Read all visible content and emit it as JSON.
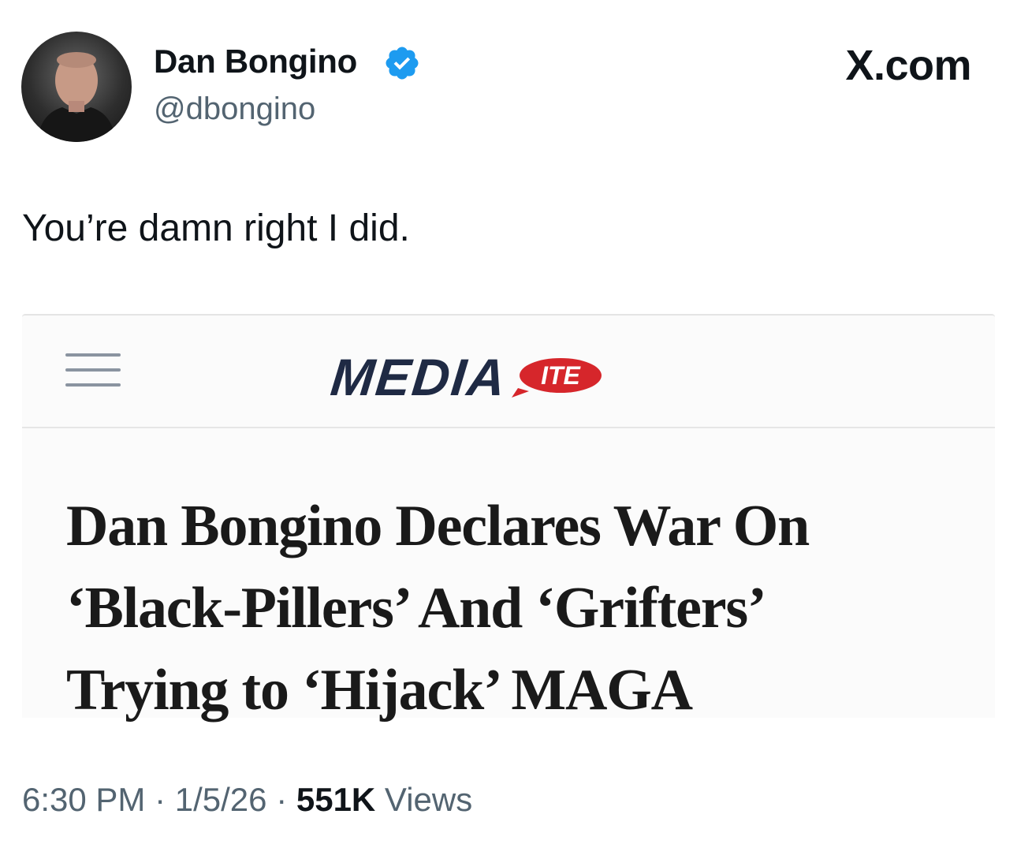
{
  "tweet": {
    "author": {
      "display_name": "Dan Bongino",
      "handle": "@dbongino",
      "verified": true,
      "verified_color": "#1d9bf0"
    },
    "brand": "X.com",
    "text": "You’re damn right I did.",
    "card": {
      "site_logo_main": "MEDIA",
      "site_logo_badge": "ITE",
      "logo_color": "#1f2a44",
      "badge_color": "#d6262b",
      "headline_lines": [
        "Dan Bongino Declares War On",
        "‘Black-Pillers’ And ‘Grifters’",
        "Trying to ‘Hijack’ MAGA"
      ]
    },
    "meta": {
      "time": "6:30 PM",
      "separator": " · ",
      "date": "1/5/26",
      "views_count": "551K",
      "views_label": " Views"
    }
  }
}
